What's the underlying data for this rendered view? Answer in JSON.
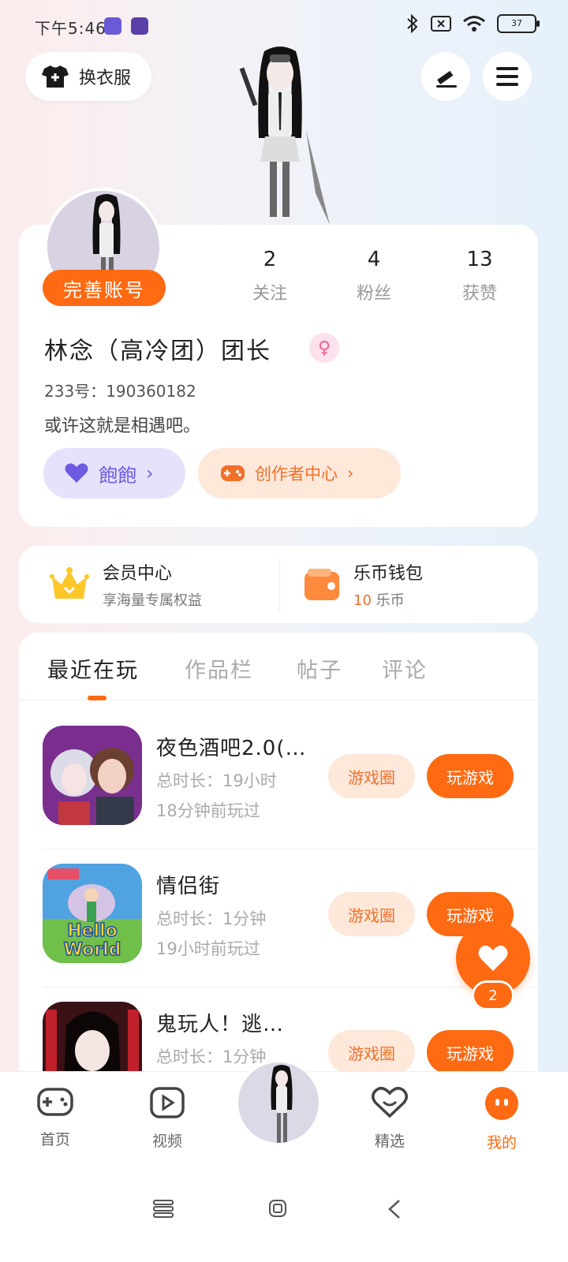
{
  "status_bar": {
    "time": "下午5:46",
    "battery": "37"
  },
  "header": {
    "change_outfit_label": "换衣服"
  },
  "profile": {
    "complete_account_label": "完善账号",
    "stats": [
      {
        "value": "2",
        "label": "关注"
      },
      {
        "value": "4",
        "label": "粉丝"
      },
      {
        "value": "13",
        "label": "获赞"
      }
    ],
    "username": "林念（高冷团）团长",
    "uid_label": "233号：",
    "uid_value": "190360182",
    "bio": "或许这就是相遇吧。",
    "bao_label": "飽飽",
    "creator_label": "创作者中心"
  },
  "vip": {
    "member_title": "会员中心",
    "member_sub": "享海量专属权益",
    "wallet_title": "乐币钱包",
    "wallet_amount": "10",
    "wallet_unit": "乐币"
  },
  "tabs": [
    "最近在玩",
    "作品栏",
    "帖子",
    "评论"
  ],
  "games": [
    {
      "title": "夜色酒吧2.0(…",
      "duration": "总时长：19小时",
      "last_played": "18分钟前玩过",
      "circle_label": "游戏圈",
      "play_label": "玩游戏"
    },
    {
      "title": "情侣街",
      "duration": "总时长：1分钟",
      "last_played": "19小时前玩过",
      "circle_label": "游戏圈",
      "play_label": "玩游戏"
    },
    {
      "title": "鬼玩人！逃…",
      "duration": "总时长：1分钟",
      "last_played": "",
      "circle_label": "游戏圈",
      "play_label": "玩游戏"
    }
  ],
  "like_fab": {
    "count": "2"
  },
  "bottom_nav": [
    {
      "label": "首页"
    },
    {
      "label": "视频"
    },
    {
      "label": "精选"
    },
    {
      "label": "我的"
    }
  ],
  "colors": {
    "accent": "#ff6a12",
    "purple": "#6d5be0"
  }
}
